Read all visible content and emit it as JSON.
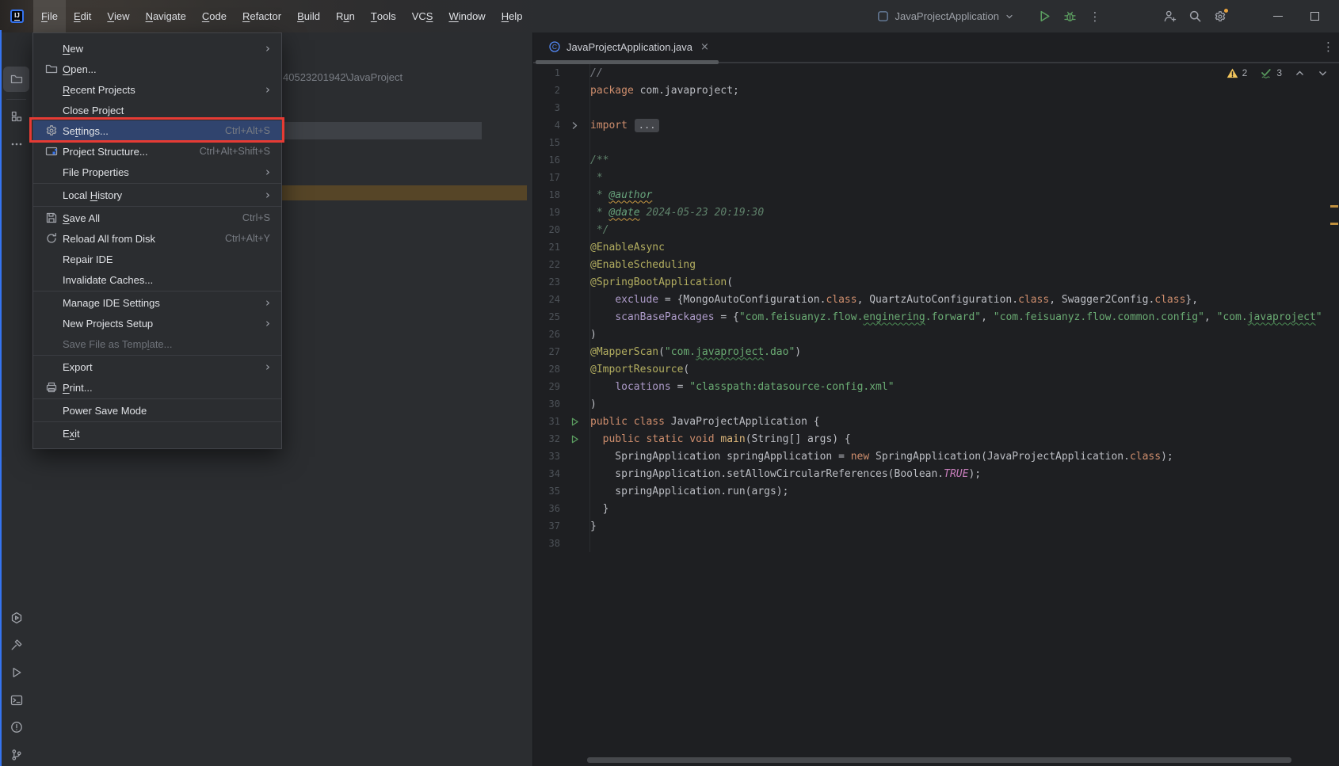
{
  "titlebar": {
    "menus": [
      {
        "label": "File",
        "u": 0,
        "active": true
      },
      {
        "label": "Edit",
        "u": 0
      },
      {
        "label": "View",
        "u": 0
      },
      {
        "label": "Navigate",
        "u": 0
      },
      {
        "label": "Code",
        "u": 0
      },
      {
        "label": "Refactor",
        "u": 0
      },
      {
        "label": "Build",
        "u": 0
      },
      {
        "label": "Run",
        "u": 1
      },
      {
        "label": "Tools",
        "u": 0
      },
      {
        "label": "VCS",
        "u": 2
      },
      {
        "label": "Window",
        "u": 0
      },
      {
        "label": "Help",
        "u": 0
      }
    ],
    "logo_text": "IJ",
    "run_config": "JavaProjectApplication",
    "more_glyph": "⋮",
    "window_buttons": [
      "minimize",
      "maximize"
    ]
  },
  "file_menu": {
    "items": [
      {
        "label": "New",
        "u": 0,
        "submenu": true
      },
      {
        "label": "Open...",
        "u": 0,
        "icon": "folder"
      },
      {
        "label": "Recent Projects",
        "u": 0,
        "submenu": true
      },
      {
        "label": "Close Project"
      },
      {
        "label": "Settings...",
        "u": 2,
        "icon": "gear",
        "shortcut": "Ctrl+Alt+S",
        "selected": true
      },
      {
        "label": "Project Structure...",
        "icon": "pstruct",
        "shortcut": "Ctrl+Alt+Shift+S"
      },
      {
        "label": "File Properties",
        "submenu": true
      },
      {
        "sep": true
      },
      {
        "label": "Local History",
        "u": 6,
        "submenu": true
      },
      {
        "sep": true
      },
      {
        "label": "Save All",
        "u": 0,
        "icon": "floppy",
        "shortcut": "Ctrl+S"
      },
      {
        "label": "Reload All from Disk",
        "icon": "reload",
        "shortcut": "Ctrl+Alt+Y"
      },
      {
        "label": "Repair IDE"
      },
      {
        "label": "Invalidate Caches..."
      },
      {
        "sep": true
      },
      {
        "label": "Manage IDE Settings",
        "submenu": true
      },
      {
        "label": "New Projects Setup",
        "submenu": true
      },
      {
        "label": "Save File as Template...",
        "u": 17,
        "disabled": true
      },
      {
        "sep": true
      },
      {
        "label": "Export",
        "submenu": true
      },
      {
        "label": "Print...",
        "u": 0,
        "icon": "printer"
      },
      {
        "sep": true
      },
      {
        "label": "Power Save Mode"
      },
      {
        "sep": true
      },
      {
        "label": "Exit",
        "u": 1
      }
    ]
  },
  "tool_stripe": {
    "top": [
      {
        "icon": "folder",
        "name": "project-tool-icon",
        "active": true
      },
      {
        "icon": "structure",
        "name": "structure-tool-icon"
      },
      {
        "icon": "more-dots",
        "name": "more-tool-windows-icon"
      }
    ],
    "bottom": [
      {
        "icon": "services",
        "name": "services-tool-icon"
      },
      {
        "icon": "build",
        "name": "build-tool-icon"
      },
      {
        "icon": "run-tool",
        "name": "run-tool-icon"
      },
      {
        "icon": "terminal",
        "name": "terminal-tool-icon"
      },
      {
        "icon": "problems",
        "name": "problems-tool-icon"
      },
      {
        "icon": "git",
        "name": "version-control-tool-icon"
      }
    ]
  },
  "project_panel": {
    "path_text": "40523201942\\JavaProject"
  },
  "editor": {
    "tab": {
      "title": "JavaProjectApplication.java",
      "icon": "java-class"
    },
    "inspections": {
      "warnings": "2",
      "ok": "3"
    },
    "lines": [
      {
        "n": "1",
        "s": [
          [
            "//",
            "cmt"
          ]
        ]
      },
      {
        "n": "2",
        "s": [
          [
            "package",
            "kw"
          ],
          [
            " com.javaproject;",
            "pl"
          ]
        ]
      },
      {
        "n": "3",
        "s": []
      },
      {
        "n": "4",
        "g": "fold",
        "s": [
          [
            "import",
            "kw"
          ],
          [
            " ",
            "pl"
          ]
        ],
        "f": "..."
      },
      {
        "n": "15",
        "s": []
      },
      {
        "n": "16",
        "s": [
          [
            "/**",
            "doc"
          ]
        ]
      },
      {
        "n": "17",
        "s": [
          [
            " *",
            "doc"
          ]
        ]
      },
      {
        "n": "18",
        "s": [
          [
            " * ",
            "doc"
          ],
          [
            "@author",
            "doctag"
          ]
        ]
      },
      {
        "n": "19",
        "s": [
          [
            " * ",
            "doc"
          ],
          [
            "@date",
            "doctag"
          ],
          [
            " 2024-05-23 20:19:30",
            "doc"
          ]
        ]
      },
      {
        "n": "20",
        "s": [
          [
            " */",
            "doc"
          ]
        ]
      },
      {
        "n": "21",
        "s": [
          [
            "@EnableAsync",
            "ann"
          ]
        ]
      },
      {
        "n": "22",
        "s": [
          [
            "@EnableScheduling",
            "ann"
          ]
        ]
      },
      {
        "n": "23",
        "s": [
          [
            "@SpringBootApplication",
            "ann"
          ],
          [
            "(",
            "pl"
          ]
        ]
      },
      {
        "n": "24",
        "s": [
          [
            "    ",
            "pl"
          ],
          [
            "exclude",
            "attr"
          ],
          [
            " = {MongoAutoConfiguration.",
            "pl"
          ],
          [
            "class",
            "kw"
          ],
          [
            ", QuartzAutoConfiguration.",
            "pl"
          ],
          [
            "class",
            "kw"
          ],
          [
            ", Swagger2Config.",
            "pl"
          ],
          [
            "class",
            "kw"
          ],
          [
            "},",
            "pl"
          ]
        ]
      },
      {
        "n": "25",
        "s": [
          [
            "    ",
            "pl"
          ],
          [
            "scanBasePackages",
            "attr"
          ],
          [
            " = {",
            "pl"
          ],
          [
            "\"com.feisuanyz.flow.",
            "str"
          ],
          [
            "enginering",
            "strw"
          ],
          [
            ".forward\"",
            "str"
          ],
          [
            ", ",
            "pl"
          ],
          [
            "\"com.feisuanyz.flow.common.config\"",
            "str"
          ],
          [
            ", ",
            "pl"
          ],
          [
            "\"com.",
            "str"
          ],
          [
            "javaproject",
            "strw"
          ],
          [
            "\"",
            "str"
          ]
        ]
      },
      {
        "n": "26",
        "s": [
          [
            ")",
            "pl"
          ]
        ]
      },
      {
        "n": "27",
        "s": [
          [
            "@MapperScan",
            "ann"
          ],
          [
            "(",
            "pl"
          ],
          [
            "\"com.",
            "str"
          ],
          [
            "javaproject",
            "strw"
          ],
          [
            ".dao\"",
            "str"
          ],
          [
            ")",
            "pl"
          ]
        ]
      },
      {
        "n": "28",
        "s": [
          [
            "@ImportResource",
            "ann"
          ],
          [
            "(",
            "pl"
          ]
        ]
      },
      {
        "n": "29",
        "s": [
          [
            "    ",
            "pl"
          ],
          [
            "locations",
            "attr"
          ],
          [
            " = ",
            "pl"
          ],
          [
            "\"classpath:datasource-config.xml\"",
            "str"
          ]
        ]
      },
      {
        "n": "30",
        "s": [
          [
            ")",
            "pl"
          ]
        ]
      },
      {
        "n": "31",
        "g": "run",
        "s": [
          [
            "public",
            "kw"
          ],
          [
            " ",
            "pl"
          ],
          [
            "class",
            "kw"
          ],
          [
            " JavaProjectApplication {",
            "pl"
          ]
        ]
      },
      {
        "n": "32",
        "g": "run",
        "s": [
          [
            "  ",
            "pl"
          ],
          [
            "public",
            "kw"
          ],
          [
            " ",
            "pl"
          ],
          [
            "static",
            "kw"
          ],
          [
            " ",
            "pl"
          ],
          [
            "void",
            "kw"
          ],
          [
            " ",
            "pl"
          ],
          [
            "main",
            "fn"
          ],
          [
            "(String[] args) {",
            "pl"
          ]
        ]
      },
      {
        "n": "33",
        "s": [
          [
            "    SpringApplication springApplication = ",
            "pl"
          ],
          [
            "new",
            "kw"
          ],
          [
            " SpringApplication(JavaProjectApplication.",
            "pl"
          ],
          [
            "class",
            "kw"
          ],
          [
            ");",
            "pl"
          ]
        ]
      },
      {
        "n": "34",
        "s": [
          [
            "    springApplication.setAllowCircularReferences(Boolean.",
            "pl"
          ],
          [
            "TRUE",
            "const"
          ],
          [
            ");",
            "pl"
          ]
        ]
      },
      {
        "n": "35",
        "s": [
          [
            "    springApplication.run(args);",
            "pl"
          ]
        ]
      },
      {
        "n": "36",
        "s": [
          [
            "  }",
            "pl"
          ]
        ]
      },
      {
        "n": "37",
        "s": [
          [
            "}",
            "pl"
          ]
        ]
      },
      {
        "n": "38",
        "s": []
      }
    ]
  }
}
